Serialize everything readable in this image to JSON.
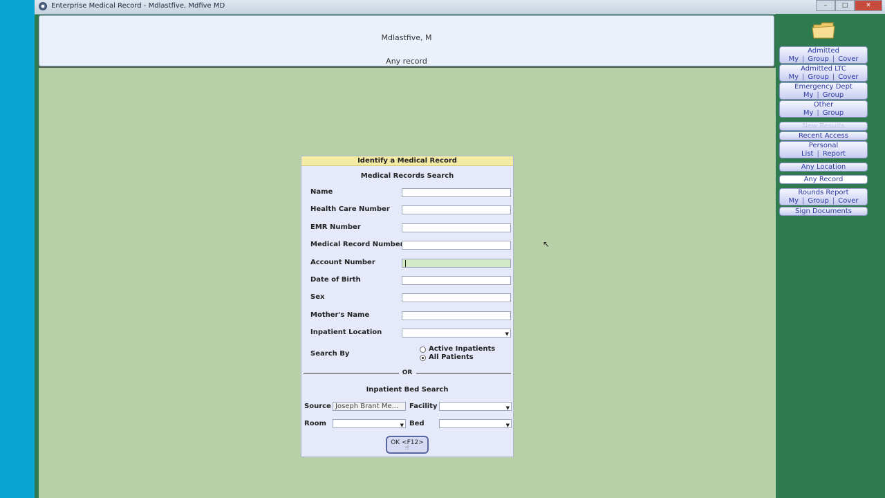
{
  "window": {
    "title": "Enterprise Medical Record - Mdlastfive, Mdfive MD",
    "controls": [
      "–",
      "□",
      "✕"
    ]
  },
  "header": {
    "patient_name": "Mdlastfive, M",
    "context": "Any record"
  },
  "dialog": {
    "title": "Identify a Medical Record",
    "section_title": "Medical Records Search",
    "fields": [
      {
        "label": "Name",
        "value": ""
      },
      {
        "label": "Health Care Number",
        "value": ""
      },
      {
        "label": "EMR Number",
        "value": ""
      },
      {
        "label": "Medical Record Number",
        "value": ""
      },
      {
        "label": "Account Number",
        "value": ""
      },
      {
        "label": "Date of Birth",
        "value": ""
      },
      {
        "label": "Sex",
        "value": ""
      },
      {
        "label": "Mother's Name",
        "value": ""
      },
      {
        "label": "Inpatient Location",
        "value": ""
      }
    ],
    "search_by": {
      "label": "Search By",
      "options": [
        "Active Inpatients",
        "All Patients"
      ],
      "selected": "All Patients"
    },
    "or_label": "OR",
    "bed_search": {
      "title": "Inpatient Bed Search",
      "source_label": "Source",
      "source_value": "Joseph Brant Me...",
      "facility_label": "Facility",
      "facility_value": "",
      "room_label": "Room",
      "room_value": "",
      "bed_label": "Bed",
      "bed_value": ""
    },
    "ok_button": "OK <F12>"
  },
  "sidebar": {
    "admitted": {
      "title": "Admitted",
      "links": [
        "My",
        "Group",
        "Cover"
      ]
    },
    "admitted_ltc": {
      "title": "Admitted LTC",
      "links": [
        "My",
        "Group",
        "Cover"
      ]
    },
    "emergency": {
      "title": "Emergency Dept",
      "links": [
        "My",
        "Group"
      ]
    },
    "other": {
      "title": "Other",
      "links": [
        "My",
        "Group"
      ]
    },
    "new_results": "New Results",
    "recent_access": "Recent Access",
    "personal": {
      "title": "Personal",
      "links": [
        "List",
        "Report"
      ]
    },
    "any_location": "Any Location",
    "any_record": "Any Record",
    "rounds_report": {
      "title": "Rounds Report",
      "links": [
        "My",
        "Group",
        "Cover"
      ]
    },
    "sign_documents": "Sign Documents"
  },
  "colors": {
    "desktop": "#0aa3cf",
    "workspace": "#b8d0a8",
    "sidebar": "#2f7a4e",
    "dialog_title": "#f4eba5",
    "active_field": "#d2ebc6",
    "nav_text": "#2b3aa0"
  }
}
